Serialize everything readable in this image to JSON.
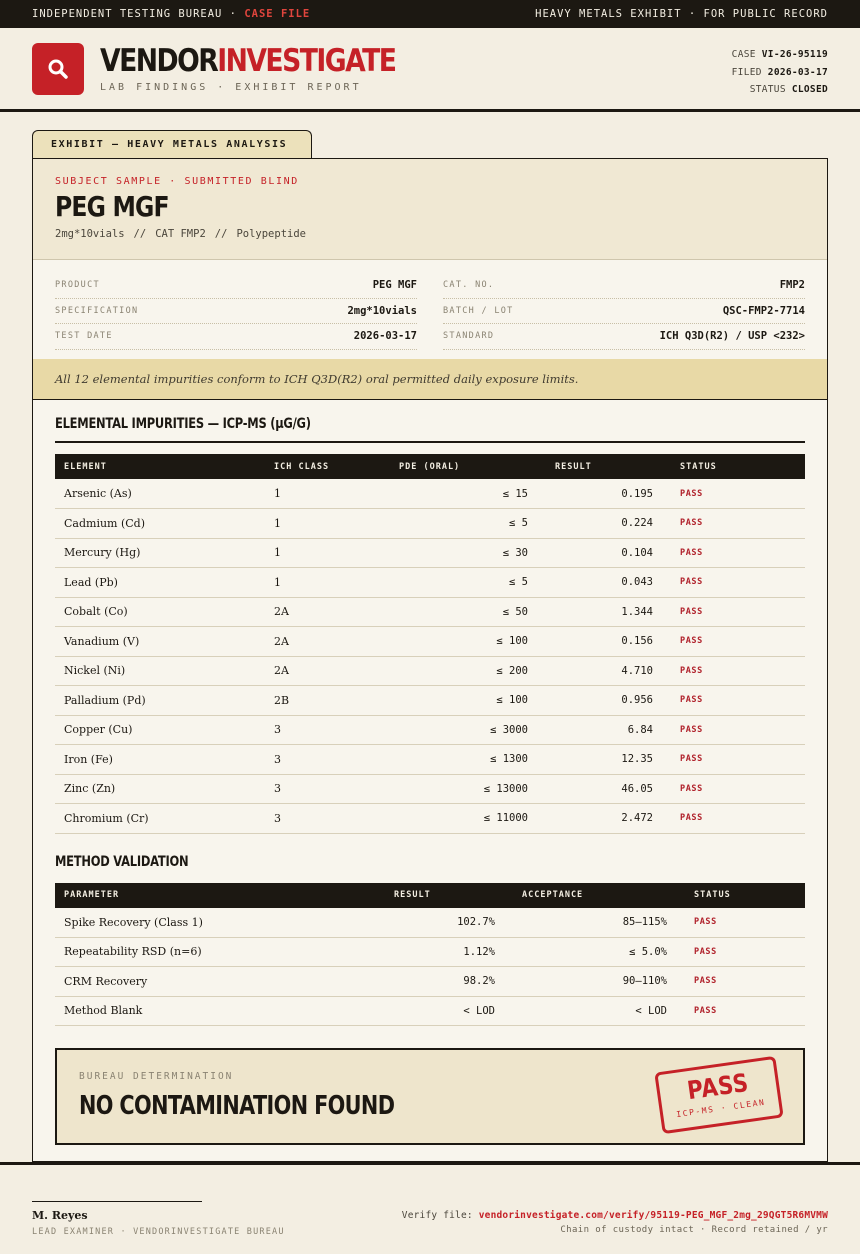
{
  "topbar": {
    "left_prefix": "INDEPENDENT TESTING BUREAU ·",
    "left_highlight": "CASE FILE",
    "right": "HEAVY METALS EXHIBIT · FOR PUBLIC RECORD"
  },
  "header": {
    "brand_part1": "VENDOR",
    "brand_part2": "INVESTIGATE",
    "subtitle": "LAB FINDINGS · EXHIBIT REPORT",
    "case_label": "CASE",
    "case_value": "VI-26-95119",
    "filed_label": "FILED",
    "filed_value": "2026-03-17",
    "status_label": "STATUS",
    "status_value": "CLOSED"
  },
  "exhibit_tab": "EXHIBIT — HEAVY METALS ANALYSIS",
  "subject": {
    "kicker": "SUBJECT SAMPLE · SUBMITTED BLIND",
    "title": "PEG MGF",
    "meta": [
      "2mg*10vials",
      "CAT FMP2",
      "Polypeptide"
    ],
    "meta_sep": "//"
  },
  "fields": {
    "left": [
      {
        "label": "PRODUCT",
        "value": "PEG MGF"
      },
      {
        "label": "SPECIFICATION",
        "value": "2mg*10vials"
      },
      {
        "label": "TEST DATE",
        "value": "2026-03-17"
      }
    ],
    "right": [
      {
        "label": "CAT. NO.",
        "value": "FMP2"
      },
      {
        "label": "BATCH / LOT",
        "value": "QSC-FMP2-7714"
      },
      {
        "label": "STANDARD",
        "value": "ICH Q3D(R2) / USP <232>"
      }
    ]
  },
  "summary": "All 12 elemental impurities conform to ICH Q3D(R2) oral permitted daily exposure limits.",
  "impurities": {
    "title": "ELEMENTAL IMPURITIES — ICP-MS (μG/G)",
    "headers": [
      "ELEMENT",
      "ICH CLASS",
      "PDE (ORAL)",
      "RESULT",
      "STATUS"
    ],
    "rows": [
      [
        "Arsenic (As)",
        "1",
        "≤ 15",
        "0.195",
        "PASS"
      ],
      [
        "Cadmium (Cd)",
        "1",
        "≤ 5",
        "0.224",
        "PASS"
      ],
      [
        "Mercury (Hg)",
        "1",
        "≤ 30",
        "0.104",
        "PASS"
      ],
      [
        "Lead (Pb)",
        "1",
        "≤ 5",
        "0.043",
        "PASS"
      ],
      [
        "Cobalt (Co)",
        "2A",
        "≤ 50",
        "1.344",
        "PASS"
      ],
      [
        "Vanadium (V)",
        "2A",
        "≤ 100",
        "0.156",
        "PASS"
      ],
      [
        "Nickel (Ni)",
        "2A",
        "≤ 200",
        "4.710",
        "PASS"
      ],
      [
        "Palladium (Pd)",
        "2B",
        "≤ 100",
        "0.956",
        "PASS"
      ],
      [
        "Copper (Cu)",
        "3",
        "≤ 3000",
        "6.84",
        "PASS"
      ],
      [
        "Iron (Fe)",
        "3",
        "≤ 1300",
        "12.35",
        "PASS"
      ],
      [
        "Zinc (Zn)",
        "3",
        "≤ 13000",
        "46.05",
        "PASS"
      ],
      [
        "Chromium (Cr)",
        "3",
        "≤ 11000",
        "2.472",
        "PASS"
      ]
    ]
  },
  "validation": {
    "title": "METHOD VALIDATION",
    "headers": [
      "PARAMETER",
      "RESULT",
      "ACCEPTANCE",
      "STATUS"
    ],
    "rows": [
      [
        "Spike Recovery (Class 1)",
        "102.7%",
        "85–115%",
        "PASS"
      ],
      [
        "Repeatability RSD (n=6)",
        "1.12%",
        "≤ 5.0%",
        "PASS"
      ],
      [
        "CRM Recovery",
        "98.2%",
        "90–110%",
        "PASS"
      ],
      [
        "Method Blank",
        "< LOD",
        "< LOD",
        "PASS"
      ]
    ]
  },
  "determination": {
    "kicker": "BUREAU DETERMINATION",
    "title": "NO CONTAMINATION FOUND",
    "stamp_main": "PASS",
    "stamp_sub": "ICP-MS · CLEAN"
  },
  "footer": {
    "examiner_name": "M. Reyes",
    "examiner_role": "LEAD EXAMINER · VENDORINVESTIGATE BUREAU",
    "verify_label": "Verify file:",
    "verify_url": "vendorinvestigate.com/verify/95119-PEG_MGF_2mg_29QGT5R6MVMW",
    "custody": "Chain of custody intact · Record retained / yr"
  },
  "colors": {
    "accent": "#c52127",
    "ink": "#1c1812",
    "paper": "#f3eee2",
    "highlight": "#e8d9a6"
  }
}
